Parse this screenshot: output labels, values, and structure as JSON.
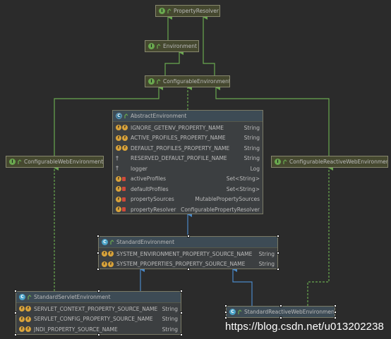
{
  "diagram": {
    "nodes": [
      {
        "id": "property-resolver",
        "label": "PropertyResolver",
        "kind": "interface"
      },
      {
        "id": "environment",
        "label": "Environment",
        "kind": "interface"
      },
      {
        "id": "configurable-environment",
        "label": "ConfigurableEnvironment",
        "kind": "interface"
      },
      {
        "id": "abstract-environment",
        "label": "AbstractEnvironment",
        "kind": "abstract-class",
        "fields": [
          {
            "name": "IGNORE_GETENV_PROPERTY_NAME",
            "type": "String",
            "icon": "public-static-final"
          },
          {
            "name": "ACTIVE_PROFILES_PROPERTY_NAME",
            "type": "String",
            "icon": "public-static-final"
          },
          {
            "name": "DEFAULT_PROFILES_PROPERTY_NAME",
            "type": "String",
            "icon": "public-static-final"
          },
          {
            "name": "RESERVED_DEFAULT_PROFILE_NAME",
            "type": "String",
            "icon": "protected-static-final"
          },
          {
            "name": "logger",
            "type": "Log",
            "icon": "protected-final"
          },
          {
            "name": "activeProfiles",
            "type": "Set<String>",
            "icon": "private-final"
          },
          {
            "name": "defaultProfiles",
            "type": "Set<String>",
            "icon": "private-final"
          },
          {
            "name": "propertySources",
            "type": "MutablePropertySources",
            "icon": "private-final"
          },
          {
            "name": "propertyResolver",
            "type": "ConfigurablePropertyResolver",
            "icon": "private-final"
          }
        ]
      },
      {
        "id": "configurable-web-environment",
        "label": "ConfigurableWebEnvironment",
        "kind": "interface"
      },
      {
        "id": "configurable-reactive-web-environment",
        "label": "ConfigurableReactiveWebEnvironment",
        "kind": "interface"
      },
      {
        "id": "standard-environment",
        "label": "StandardEnvironment",
        "kind": "class",
        "fields": [
          {
            "name": "SYSTEM_ENVIRONMENT_PROPERTY_SOURCE_NAME",
            "type": "String",
            "icon": "public-static-final"
          },
          {
            "name": "SYSTEM_PROPERTIES_PROPERTY_SOURCE_NAME",
            "type": "String",
            "icon": "public-static-final"
          }
        ]
      },
      {
        "id": "standard-servlet-environment",
        "label": "StandardServletEnvironment",
        "kind": "class",
        "fields": [
          {
            "name": "SERVLET_CONTEXT_PROPERTY_SOURCE_NAME",
            "type": "String",
            "icon": "public-static-final"
          },
          {
            "name": "SERVLET_CONFIG_PROPERTY_SOURCE_NAME",
            "type": "String",
            "icon": "public-static-final"
          },
          {
            "name": "JNDI_PROPERTY_SOURCE_NAME",
            "type": "String",
            "icon": "public-static-final"
          }
        ]
      },
      {
        "id": "standard-reactive-web-environment",
        "label": "StandardReactiveWebEnvironment",
        "kind": "class"
      }
    ],
    "edges": [
      {
        "from": "environment",
        "to": "property-resolver",
        "type": "extends"
      },
      {
        "from": "configurable-environment",
        "to": "environment",
        "type": "extends"
      },
      {
        "from": "configurable-environment",
        "to": "property-resolver",
        "type": "extends"
      },
      {
        "from": "abstract-environment",
        "to": "configurable-environment",
        "type": "implements"
      },
      {
        "from": "configurable-web-environment",
        "to": "configurable-environment",
        "type": "extends"
      },
      {
        "from": "configurable-reactive-web-environment",
        "to": "configurable-environment",
        "type": "extends"
      },
      {
        "from": "standard-environment",
        "to": "abstract-environment",
        "type": "extends"
      },
      {
        "from": "standard-servlet-environment",
        "to": "standard-environment",
        "type": "extends"
      },
      {
        "from": "standard-servlet-environment",
        "to": "configurable-web-environment",
        "type": "implements"
      },
      {
        "from": "standard-reactive-web-environment",
        "to": "standard-environment",
        "type": "extends"
      },
      {
        "from": "standard-reactive-web-environment",
        "to": "configurable-reactive-web-environment",
        "type": "implements"
      }
    ],
    "colors": {
      "background": "#2b2b2b",
      "interface_edge": "#6aa84f",
      "class_edge": "#4a88c7",
      "node_border": "#7a7a66"
    }
  },
  "watermark": "https://blog.csdn.net/u013202238"
}
